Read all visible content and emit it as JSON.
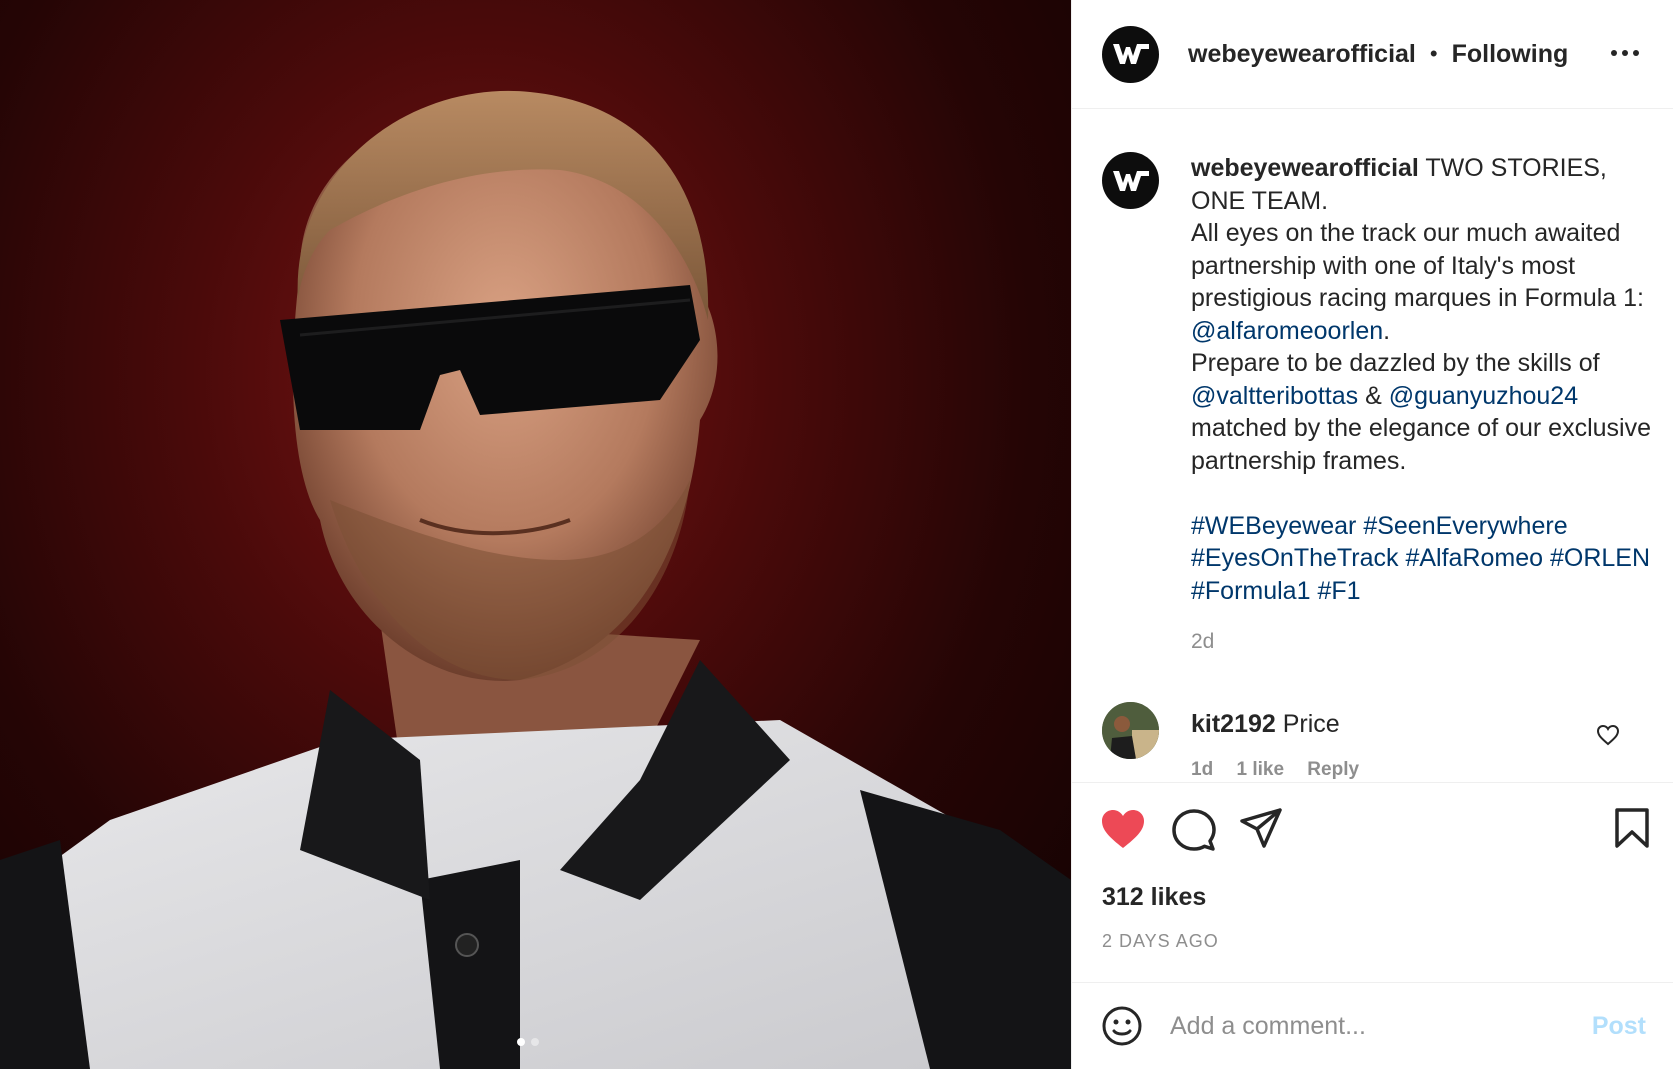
{
  "post": {
    "username": "webeyewearofficial",
    "follow_status": "Following",
    "separator": "•",
    "caption": {
      "username": "webeyewearofficial",
      "line1": " TWO STORIES, ONE TEAM.",
      "line2": "All eyes on the track our much awaited partnership with one of Italy's most prestigious racing marques in Formula 1: ",
      "mention1": "@alfaromeoorlen",
      "line2_end": ".",
      "line3": "Prepare to be dazzled by the skills of ",
      "mention2": "@valtteribottas",
      "amp": " & ",
      "mention3": "@guanyuzhou24",
      "line4": " matched by the elegance of our exclusive partnership frames.",
      "hashtags": [
        "#WEBeyewear",
        "#SeenEverywhere",
        "#EyesOnTheTrack",
        "#AlfaRomeo",
        "#ORLEN",
        "#Formula1",
        "#F1"
      ]
    },
    "caption_time": "2d",
    "likes": "312 likes",
    "posted_ago": "2 DAYS AGO"
  },
  "comments": [
    {
      "username": "kit2192",
      "text": " Price",
      "time": "1d",
      "likes": "1 like",
      "reply": "Reply"
    }
  ],
  "add_comment": {
    "placeholder": "Add a comment...",
    "post_label": "Post"
  },
  "carousel": {
    "total": 2,
    "active": 1
  },
  "colors": {
    "like_active": "#ed4956",
    "link": "#00376b",
    "post_disabled": "#b2dffc",
    "muted": "#8e8e8e"
  },
  "icons": [
    "more-icon",
    "heart-icon",
    "comment-icon",
    "share-icon",
    "bookmark-icon",
    "emoji-icon",
    "heart-outline-icon",
    "webeyewear-logo"
  ]
}
